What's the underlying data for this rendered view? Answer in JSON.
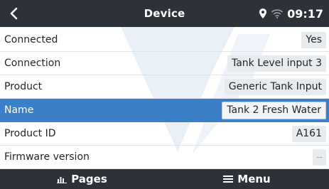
{
  "header": {
    "title": "Device",
    "time": "09:17",
    "back_icon": "chevron-left-icon",
    "location_icon": "location-pin-icon",
    "wifi_icon": "wifi-icon"
  },
  "rows": [
    {
      "label": "Connected",
      "value": "Yes"
    },
    {
      "label": "Connection",
      "value": "Tank Level input 3"
    },
    {
      "label": "Product",
      "value": "Generic Tank Input"
    },
    {
      "label": "Name",
      "value": "Tank 2 Fresh Water",
      "selected": true
    },
    {
      "label": "Product ID",
      "value": "A161"
    },
    {
      "label": "Firmware version",
      "value": "--"
    }
  ],
  "footer": {
    "pages_label": "Pages",
    "menu_label": "Menu",
    "pages_icon": "chart-icon",
    "menu_icon": "hamburger-icon"
  },
  "colors": {
    "bar": "#2c3238",
    "selection": "#3a7fc7",
    "value_bg": "#e9ecef"
  }
}
